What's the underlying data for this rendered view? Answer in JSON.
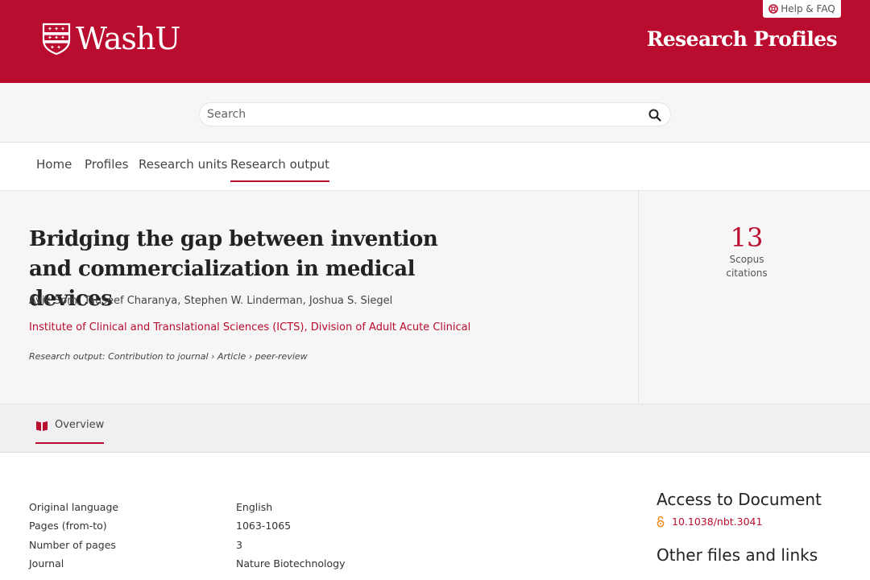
{
  "header": {
    "logo_text": "WashU",
    "help_label": "Help & FAQ",
    "site_title": "Research Profiles"
  },
  "search": {
    "placeholder": "Search"
  },
  "nav": {
    "items": [
      {
        "label": "Home"
      },
      {
        "label": "Profiles"
      },
      {
        "label": "Research units"
      },
      {
        "label": "Research output"
      }
    ],
    "active": "Research output"
  },
  "article": {
    "title": "Bridging the gap between invention and commercialization in medical devices",
    "authors": "Avik Som, Tauseef Charanya, Stephen W. Linderman, Joshua S. Siegel",
    "units": "Institute of Clinical and Translational Sciences (ICTS), Division of Adult Acute Clinical",
    "research_type": "Research output: Contribution to journal › Article › peer-review"
  },
  "citations": {
    "count": "13",
    "label_line1": "Scopus",
    "label_line2": "citations"
  },
  "tabs": {
    "overview_label": "Overview"
  },
  "details": [
    {
      "label": "Original language",
      "value": "English"
    },
    {
      "label": "Pages (from-to)",
      "value": "1063-1065"
    },
    {
      "label": "Number of pages",
      "value": "3"
    },
    {
      "label": "Journal",
      "value": "Nature Biotechnology"
    }
  ],
  "sidebar": {
    "access_heading": "Access to Document",
    "doi": "10.1038/nbt.3041",
    "other_heading": "Other files and links"
  },
  "colors": {
    "brand": "#ba0c2f",
    "open_access": "#f08c1e"
  },
  "icons": [
    "shield-logo-icon",
    "lifebuoy-icon",
    "search-icon",
    "book-icon",
    "open-access-icon"
  ]
}
